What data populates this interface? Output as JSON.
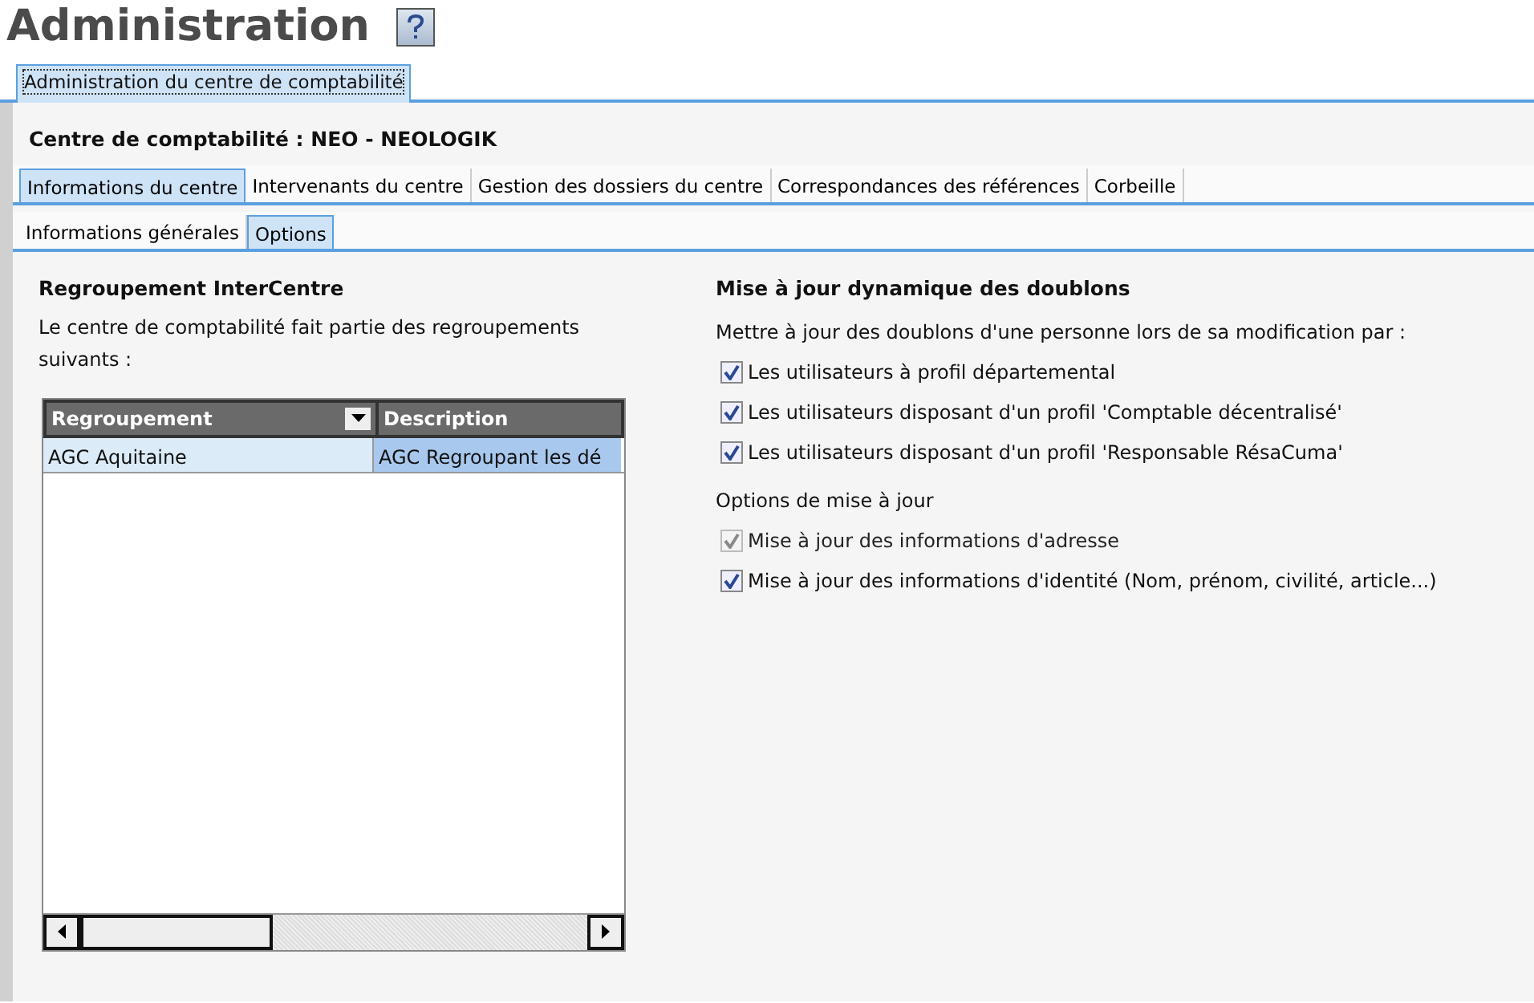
{
  "page_title": "Administration",
  "outer_tabs": [
    {
      "label": "Administration du centre de comptabilité",
      "selected": true
    }
  ],
  "center_label": "Centre de comptabilité : NEO - NEOLOGIK",
  "tabs": [
    {
      "label": "Informations du centre",
      "selected": true
    },
    {
      "label": "Intervenants du centre",
      "selected": false
    },
    {
      "label": "Gestion des dossiers du centre",
      "selected": false
    },
    {
      "label": "Correspondances des références",
      "selected": false
    },
    {
      "label": "Corbeille",
      "selected": false
    }
  ],
  "sub_tabs": [
    {
      "label": "Informations générales",
      "selected": false
    },
    {
      "label": "Options",
      "selected": true
    }
  ],
  "regroupement": {
    "heading": "Regroupement InterCentre",
    "description": "Le centre de comptabilité fait partie des regroupements suivants :",
    "table": {
      "columns": [
        "Regroupement",
        "Description"
      ],
      "rows": [
        {
          "cells": [
            "AGC Aquitaine",
            "AGC Regroupant les dé"
          ],
          "selected": true
        }
      ]
    }
  },
  "doublons": {
    "heading": "Mise à jour dynamique des doublons",
    "intro": "Mettre à jour des doublons d'une personne lors de sa modification par :",
    "profiles": [
      {
        "label": "Les utilisateurs à profil départemental",
        "checked": true,
        "disabled": false
      },
      {
        "label": "Les utilisateurs disposant d'un profil 'Comptable décentralisé'",
        "checked": true,
        "disabled": false
      },
      {
        "label": "Les utilisateurs disposant d'un profil 'Responsable RésaCuma'",
        "checked": true,
        "disabled": false
      }
    ],
    "options_heading": "Options de mise à jour",
    "options": [
      {
        "label": "Mise à jour des informations d'adresse",
        "checked": true,
        "disabled": true
      },
      {
        "label": "Mise à jour des informations d'identité (Nom, prénom, civilité, article...)",
        "checked": true,
        "disabled": false
      }
    ]
  }
}
